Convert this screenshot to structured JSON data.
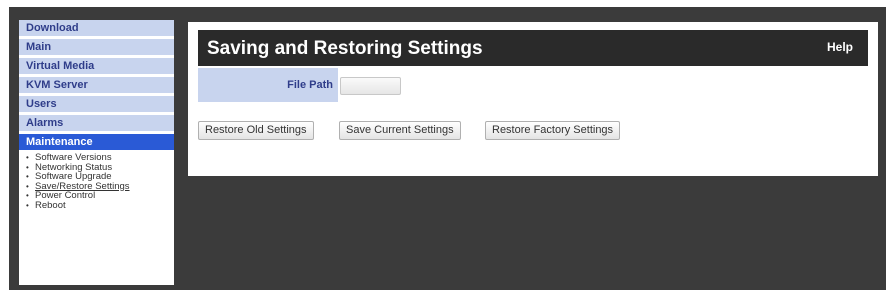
{
  "sidebar": {
    "items": [
      {
        "label": "Download",
        "active": false
      },
      {
        "label": "Main",
        "active": false
      },
      {
        "label": "Virtual Media",
        "active": false
      },
      {
        "label": "KVM Server",
        "active": false
      },
      {
        "label": "Users",
        "active": false
      },
      {
        "label": "Alarms",
        "active": false
      },
      {
        "label": "Maintenance",
        "active": true
      }
    ],
    "submenu": [
      {
        "label": "Software Versions"
      },
      {
        "label": "Networking Status"
      },
      {
        "label": "Software Upgrade"
      },
      {
        "label": "Save/Restore Settings",
        "current": true
      },
      {
        "label": "Power Control"
      },
      {
        "label": "Reboot"
      }
    ]
  },
  "main": {
    "title": "Saving and Restoring Settings",
    "help_label": "Help",
    "file_path_label": "File Path",
    "file_path_value": "",
    "buttons": {
      "restore_old": "Restore Old Settings",
      "save_current": "Save Current Settings",
      "restore_factory": "Restore Factory Settings"
    }
  },
  "colors": {
    "nav_bg": "#c8d4ee",
    "nav_text": "#2f3d8a",
    "nav_active_bg": "#2a5ad6",
    "title_bg": "#2a2a2a",
    "frame_bg": "#3b3b3b"
  }
}
